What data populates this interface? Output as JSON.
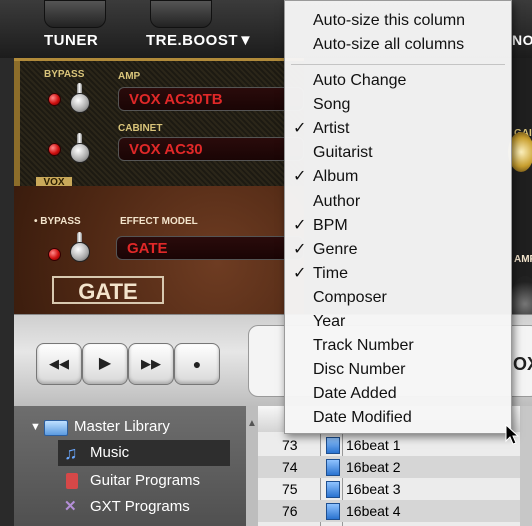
{
  "toolbar": {
    "tuner": "TUNER",
    "treble_boost": "TRE.BOOST▼",
    "clipped_right": "NOI"
  },
  "amp": {
    "bypass_label": "BYPASS",
    "amp_label": "AMP",
    "amp_model": "VOX AC30TB",
    "cabinet_label": "CABINET",
    "cabinet_model": "VOX AC30",
    "badge": "VOX",
    "right_label": "GAIN"
  },
  "effect": {
    "bypass_label": "• BYPASS",
    "model_label": "EFFECT MODEL",
    "model": "GATE",
    "nameplate": "GATE",
    "right_label": "AMP"
  },
  "transport": {
    "rewind_icon": "◀◀",
    "play_icon": "▶",
    "forward_icon": "▶▶",
    "record_icon": "●",
    "lcd_fragment": "OX"
  },
  "library": {
    "items": [
      {
        "label": "Master Library",
        "icon": "folder-icon"
      },
      {
        "label": "Music",
        "icon": "music-note-icon"
      },
      {
        "label": "Guitar Programs",
        "icon": "guitar-program-icon"
      },
      {
        "label": "GXT Programs",
        "icon": "gxt-icon"
      }
    ]
  },
  "tracks": {
    "rows": [
      {
        "num": "73",
        "name": "16beat 1"
      },
      {
        "num": "74",
        "name": "16beat 2"
      },
      {
        "num": "75",
        "name": "16beat 3"
      },
      {
        "num": "76",
        "name": "16beat 4"
      }
    ]
  },
  "menu": {
    "top_items": [
      "Auto-size this column",
      "Auto-size all columns"
    ],
    "columns": [
      {
        "label": "Auto Change",
        "checked": false
      },
      {
        "label": "Song",
        "checked": false
      },
      {
        "label": "Artist",
        "checked": true
      },
      {
        "label": "Guitarist",
        "checked": false
      },
      {
        "label": "Album",
        "checked": true
      },
      {
        "label": "Author",
        "checked": false
      },
      {
        "label": "BPM",
        "checked": true
      },
      {
        "label": "Genre",
        "checked": true
      },
      {
        "label": "Time",
        "checked": true
      },
      {
        "label": "Composer",
        "checked": false
      },
      {
        "label": "Year",
        "checked": false
      },
      {
        "label": "Track Number",
        "checked": false
      },
      {
        "label": "Disc Number",
        "checked": false
      },
      {
        "label": "Date Added",
        "checked": false
      },
      {
        "label": "Date Modified",
        "checked": false
      }
    ],
    "check_glyph": "✓"
  }
}
